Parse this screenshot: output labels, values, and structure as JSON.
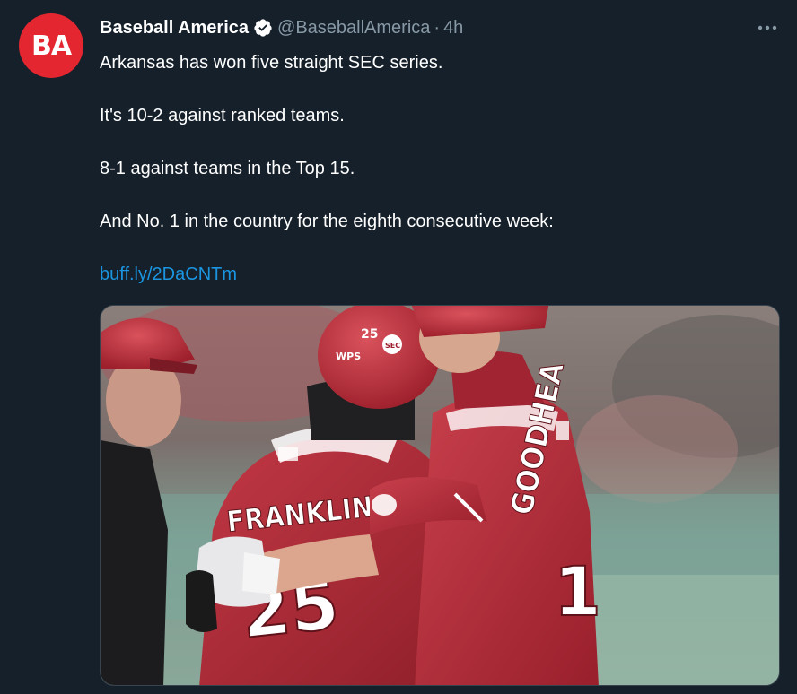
{
  "author": {
    "avatar_text": "BA",
    "display_name": "Baseball America",
    "handle": "@BaseballAmerica",
    "separator": "·",
    "time": "4h"
  },
  "tweet": {
    "lines": [
      "Arkansas has won five straight SEC series.",
      "It's 10-2 against ranked teams.",
      "8-1 against teams in the Top 15.",
      "And No. 1 in the country for the eighth consecutive week:"
    ],
    "link": "buff.ly/2DaCNTm"
  },
  "media": {
    "left_jersey_name": "FRANKLIN",
    "left_jersey_number": "25",
    "right_jersey_name": "GOODHEA",
    "right_jersey_number": "1",
    "helmet_number": "25",
    "helmet_badge": "SEC",
    "helmet_sticker": "WPS"
  },
  "colors": {
    "background": "#15202b",
    "secondary_text": "#8899a6",
    "link": "#1b95e0",
    "avatar_red": "#e3262f",
    "jersey_red": "#b22a37"
  },
  "icons": {
    "verified": "verified-badge-icon",
    "more": "more-dots-icon"
  }
}
